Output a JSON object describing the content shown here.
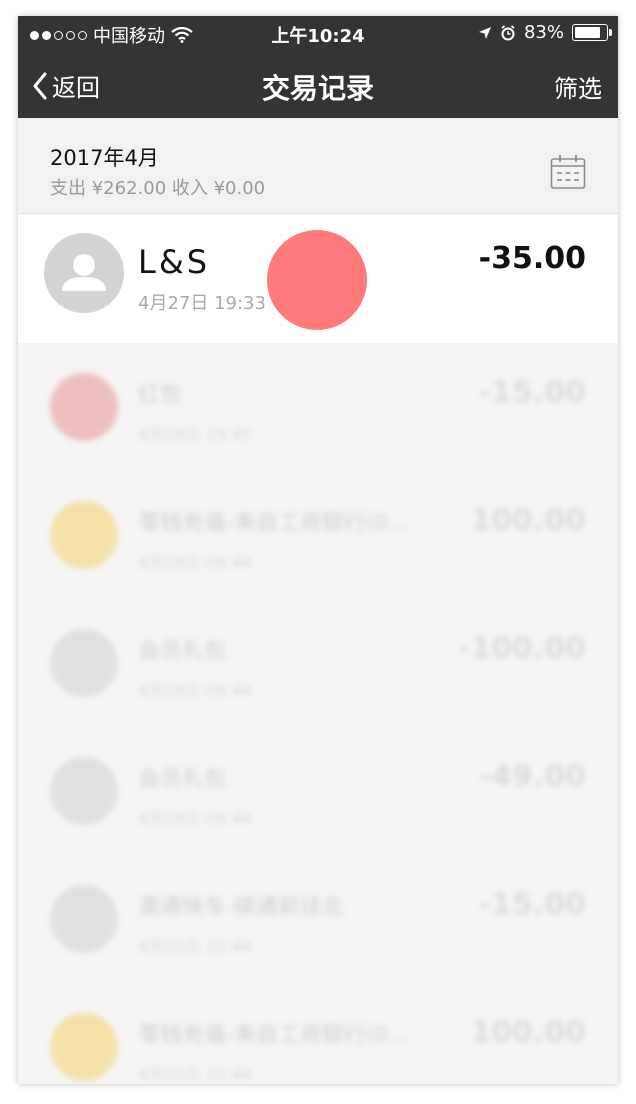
{
  "status_bar": {
    "carrier": "中国移动",
    "time": "上午10:24",
    "battery": "83%",
    "battery_level": 0.83
  },
  "nav": {
    "back_label": "返回",
    "title": "交易记录",
    "filter_label": "筛选"
  },
  "month": {
    "title": "2017年4月",
    "summary": "支出 ¥262.00 收入 ¥0.00"
  },
  "focused_transaction": {
    "name": "L&S",
    "time": "4月27日 19:33",
    "amount": "-35.00"
  },
  "blurred_transactions": [
    {
      "icon": "red-packet-icon",
      "color": "#e88a8a",
      "name": "红包",
      "time": "4月26日 19:45",
      "amount": "-15.00"
    },
    {
      "icon": "diamond-icon",
      "color": "#f2cf5b",
      "name": "零钱充值-来自工商银行(0...",
      "time": "4月26日 09:44",
      "amount": "100.00"
    },
    {
      "icon": "user-icon",
      "color": "#cccccc",
      "name": "会员礼包",
      "time": "4月26日 09:44",
      "amount": "-100.00"
    },
    {
      "icon": "user-icon",
      "color": "#cccccc",
      "name": "会员礼包",
      "time": "4月26日 09:44",
      "amount": "-49.00"
    },
    {
      "icon": "user-icon",
      "color": "#cccccc",
      "name": "滴滴快车-缤通前往北",
      "time": "4月25日 21:44",
      "amount": "-15.00"
    },
    {
      "icon": "diamond-icon",
      "color": "#f2cf5b",
      "name": "零钱充值-来自工商银行(0...",
      "time": "4月25日 21:44",
      "amount": "100.00"
    }
  ],
  "colors": {
    "bar_bg": "#343437",
    "page_bg": "#f5f5f5",
    "touch": "#ff7373"
  }
}
